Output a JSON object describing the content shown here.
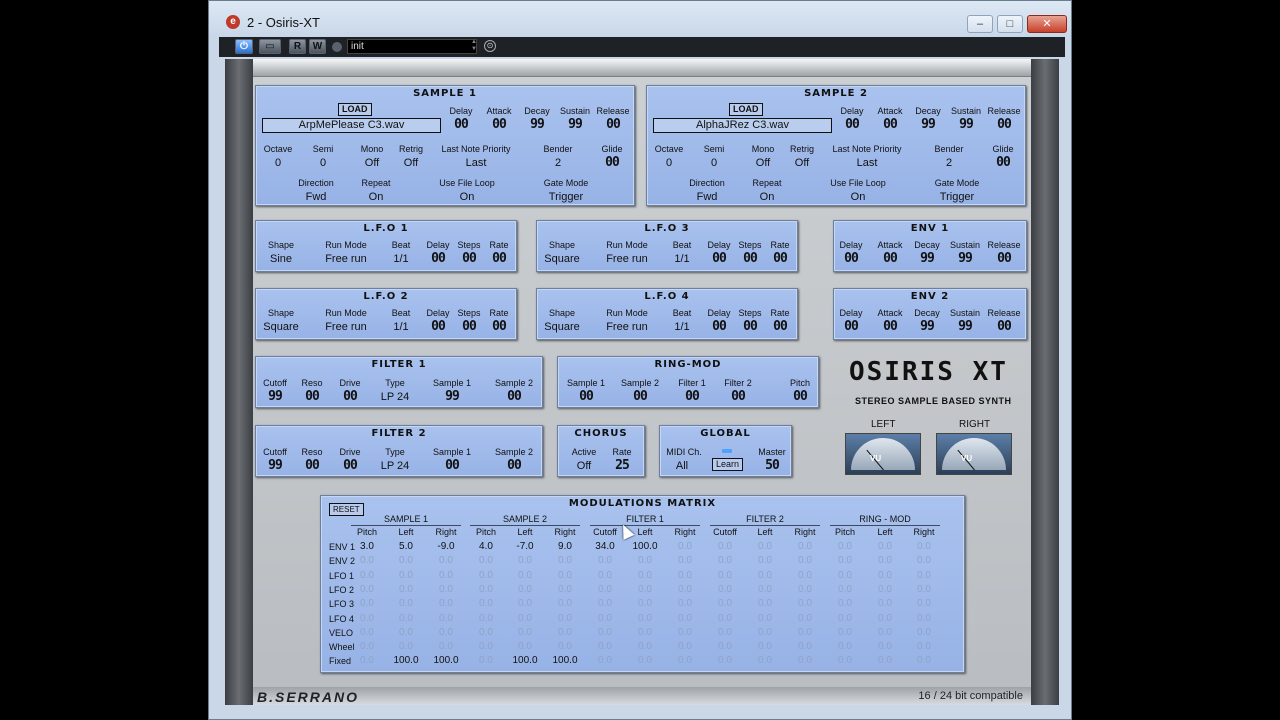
{
  "window": {
    "title": "2 - Osiris-XT",
    "app_icon": "cubase-icon",
    "minimize": "–",
    "maximize": "□",
    "close": "✕"
  },
  "toolbar": {
    "power": "⏻",
    "bypass": "▭",
    "read": "R",
    "write": "W",
    "preset": "init",
    "preset_menu": "⊙"
  },
  "sample1": {
    "title": "SAMPLE 1",
    "load": "LOAD",
    "file": "ArpMePlease  C3.wav",
    "delay_l": "Delay",
    "delay": "00",
    "attack_l": "Attack",
    "attack": "00",
    "decay_l": "Decay",
    "decay": "99",
    "sustain_l": "Sustain",
    "sustain": "99",
    "release_l": "Release",
    "release": "00",
    "octave_l": "Octave",
    "octave": "0",
    "semi_l": "Semi",
    "semi": "0",
    "mono_l": "Mono",
    "mono": "Off",
    "retrig_l": "Retrig",
    "retrig": "Off",
    "lnp_l": "Last Note Priority",
    "lnp": "Last",
    "bender_l": "Bender",
    "bender": "2",
    "glide_l": "Glide",
    "glide": "00",
    "direction_l": "Direction",
    "direction": "Fwd",
    "repeat_l": "Repeat",
    "repeat": "On",
    "loop_l": "Use File Loop",
    "loop": "On",
    "gate_l": "Gate Mode",
    "gate": "Trigger"
  },
  "sample2": {
    "title": "SAMPLE 2",
    "load": "LOAD",
    "file": "AlphaJRez  C3.wav",
    "delay_l": "Delay",
    "delay": "00",
    "attack_l": "Attack",
    "attack": "00",
    "decay_l": "Decay",
    "decay": "99",
    "sustain_l": "Sustain",
    "sustain": "99",
    "release_l": "Release",
    "release": "00",
    "octave_l": "Octave",
    "octave": "0",
    "semi_l": "Semi",
    "semi": "0",
    "mono_l": "Mono",
    "mono": "Off",
    "retrig_l": "Retrig",
    "retrig": "Off",
    "lnp_l": "Last Note Priority",
    "lnp": "Last",
    "bender_l": "Bender",
    "bender": "2",
    "glide_l": "Glide",
    "glide": "00",
    "direction_l": "Direction",
    "direction": "Fwd",
    "repeat_l": "Repeat",
    "repeat": "On",
    "loop_l": "Use File Loop",
    "loop": "On",
    "gate_l": "Gate Mode",
    "gate": "Trigger"
  },
  "lfo1": {
    "title": "L.F.O 1",
    "shape_l": "Shape",
    "shape": "Sine",
    "run_l": "Run Mode",
    "run": "Free run",
    "beat_l": "Beat",
    "beat": "1/1",
    "delay_l": "Delay",
    "delay": "00",
    "steps_l": "Steps",
    "steps": "00",
    "rate_l": "Rate",
    "rate": "00"
  },
  "lfo2": {
    "title": "L.F.O 2",
    "shape_l": "Shape",
    "shape": "Square",
    "run_l": "Run Mode",
    "run": "Free run",
    "beat_l": "Beat",
    "beat": "1/1",
    "delay_l": "Delay",
    "delay": "00",
    "steps_l": "Steps",
    "steps": "00",
    "rate_l": "Rate",
    "rate": "00"
  },
  "lfo3": {
    "title": "L.F.O 3",
    "shape_l": "Shape",
    "shape": "Square",
    "run_l": "Run Mode",
    "run": "Free run",
    "beat_l": "Beat",
    "beat": "1/1",
    "delay_l": "Delay",
    "delay": "00",
    "steps_l": "Steps",
    "steps": "00",
    "rate_l": "Rate",
    "rate": "00"
  },
  "lfo4": {
    "title": "L.F.O 4",
    "shape_l": "Shape",
    "shape": "Square",
    "run_l": "Run Mode",
    "run": "Free run",
    "beat_l": "Beat",
    "beat": "1/1",
    "delay_l": "Delay",
    "delay": "00",
    "steps_l": "Steps",
    "steps": "00",
    "rate_l": "Rate",
    "rate": "00"
  },
  "env1": {
    "title": "ENV 1",
    "delay_l": "Delay",
    "delay": "00",
    "attack_l": "Attack",
    "attack": "00",
    "decay_l": "Decay",
    "decay": "99",
    "sustain_l": "Sustain",
    "sustain": "99",
    "release_l": "Release",
    "release": "00"
  },
  "env2": {
    "title": "ENV 2",
    "delay_l": "Delay",
    "delay": "00",
    "attack_l": "Attack",
    "attack": "00",
    "decay_l": "Decay",
    "decay": "99",
    "sustain_l": "Sustain",
    "sustain": "99",
    "release_l": "Release",
    "release": "00"
  },
  "filter1": {
    "title": "FILTER 1",
    "cutoff_l": "Cutoff",
    "cutoff": "99",
    "reso_l": "Reso",
    "reso": "00",
    "drive_l": "Drive",
    "drive": "00",
    "type_l": "Type",
    "type": "LP 24",
    "s1_l": "Sample 1",
    "s1": "99",
    "s2_l": "Sample 2",
    "s2": "00"
  },
  "filter2": {
    "title": "FILTER 2",
    "cutoff_l": "Cutoff",
    "cutoff": "99",
    "reso_l": "Reso",
    "reso": "00",
    "drive_l": "Drive",
    "drive": "00",
    "type_l": "Type",
    "type": "LP 24",
    "s1_l": "Sample 1",
    "s1": "00",
    "s2_l": "Sample 2",
    "s2": "00"
  },
  "ringmod": {
    "title": "RING-MOD",
    "s1_l": "Sample 1",
    "s1": "00",
    "s2_l": "Sample 2",
    "s2": "00",
    "f1_l": "Filter 1",
    "f1": "00",
    "f2_l": "Filter 2",
    "f2": "00",
    "pitch_l": "Pitch",
    "pitch": "00"
  },
  "chorus": {
    "title": "CHORUS",
    "active_l": "Active",
    "active": "Off",
    "rate_l": "Rate",
    "rate": "25"
  },
  "global": {
    "title": "GLOBAL",
    "midi_l": "MIDI Ch.",
    "midi": "All",
    "learn": "Learn",
    "master_l": "Master",
    "master": "50"
  },
  "logo": {
    "name": "OSIRIS XT",
    "subtitle": "STEREO SAMPLE BASED SYNTH",
    "left": "LEFT",
    "right": "RIGHT",
    "vu_text": "VU"
  },
  "matrix": {
    "title": "MODULATIONS MATRIX",
    "reset": "RESET",
    "groups": [
      "SAMPLE 1",
      "SAMPLE 2",
      "FILTER 1",
      "FILTER 2",
      "RING - MOD"
    ],
    "columns": [
      "Pitch",
      "Left",
      "Right",
      "Pitch",
      "Left",
      "Right",
      "Cutoff",
      "Left",
      "Right",
      "Cutoff",
      "Left",
      "Right",
      "Pitch",
      "Left",
      "Right"
    ],
    "rows": [
      {
        "label": "ENV 1",
        "values": [
          "3.0",
          "5.0",
          "-9.0",
          "4.0",
          "-7.0",
          "9.0",
          "34.0",
          "100.0",
          "0.0",
          "0.0",
          "0.0",
          "0.0",
          "0.0",
          "0.0",
          "0.0"
        ]
      },
      {
        "label": "ENV 2",
        "values": [
          "0.0",
          "0.0",
          "0.0",
          "0.0",
          "0.0",
          "0.0",
          "0.0",
          "0.0",
          "0.0",
          "0.0",
          "0.0",
          "0.0",
          "0.0",
          "0.0",
          "0.0"
        ]
      },
      {
        "label": "LFO 1",
        "values": [
          "0.0",
          "0.0",
          "0.0",
          "0.0",
          "0.0",
          "0.0",
          "0.0",
          "0.0",
          "0.0",
          "0.0",
          "0.0",
          "0.0",
          "0.0",
          "0.0",
          "0.0"
        ]
      },
      {
        "label": "LFO 2",
        "values": [
          "0.0",
          "0.0",
          "0.0",
          "0.0",
          "0.0",
          "0.0",
          "0.0",
          "0.0",
          "0.0",
          "0.0",
          "0.0",
          "0.0",
          "0.0",
          "0.0",
          "0.0"
        ]
      },
      {
        "label": "LFO 3",
        "values": [
          "0.0",
          "0.0",
          "0.0",
          "0.0",
          "0.0",
          "0.0",
          "0.0",
          "0.0",
          "0.0",
          "0.0",
          "0.0",
          "0.0",
          "0.0",
          "0.0",
          "0.0"
        ]
      },
      {
        "label": "LFO 4",
        "values": [
          "0.0",
          "0.0",
          "0.0",
          "0.0",
          "0.0",
          "0.0",
          "0.0",
          "0.0",
          "0.0",
          "0.0",
          "0.0",
          "0.0",
          "0.0",
          "0.0",
          "0.0"
        ]
      },
      {
        "label": "VELO",
        "values": [
          "0.0",
          "0.0",
          "0.0",
          "0.0",
          "0.0",
          "0.0",
          "0.0",
          "0.0",
          "0.0",
          "0.0",
          "0.0",
          "0.0",
          "0.0",
          "0.0",
          "0.0"
        ]
      },
      {
        "label": "Wheel",
        "values": [
          "0.0",
          "0.0",
          "0.0",
          "0.0",
          "0.0",
          "0.0",
          "0.0",
          "0.0",
          "0.0",
          "0.0",
          "0.0",
          "0.0",
          "0.0",
          "0.0",
          "0.0"
        ]
      },
      {
        "label": "Fixed",
        "values": [
          "0.0",
          "100.0",
          "100.0",
          "0.0",
          "100.0",
          "100.0",
          "0.0",
          "0.0",
          "0.0",
          "0.0",
          "0.0",
          "0.0",
          "0.0",
          "0.0",
          "0.0"
        ]
      }
    ]
  },
  "footer": {
    "brand": "B.SERRANO",
    "compat": "16 / 24 bit compatible"
  },
  "colors": {
    "panel_blue": "#a9c2ee",
    "active_value": "#111111",
    "inactive_value": "#8fa3c7",
    "close_red": "#c7402a"
  }
}
